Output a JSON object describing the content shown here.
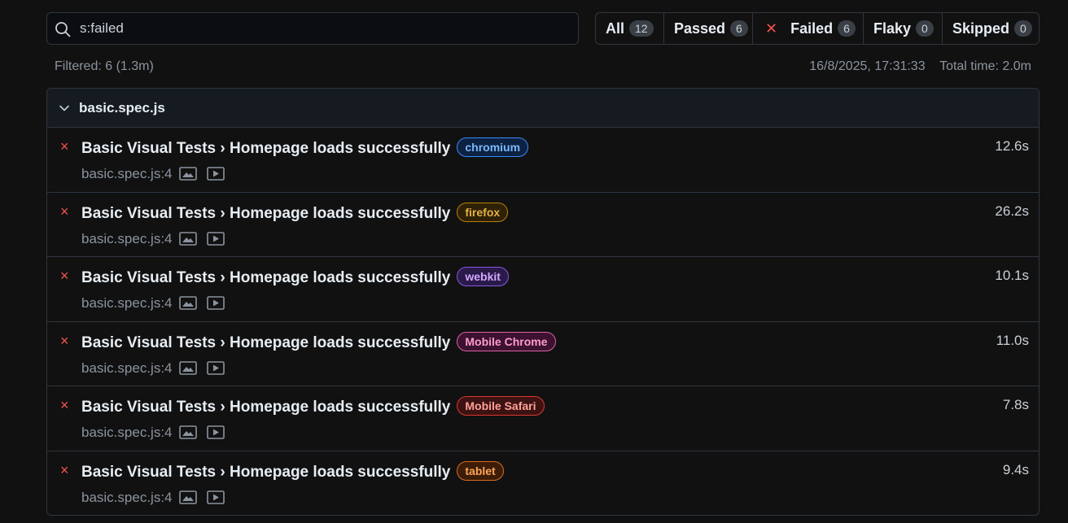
{
  "search": {
    "value": "s:failed",
    "placeholder": ""
  },
  "filters": [
    {
      "label": "All",
      "count": "12",
      "active": false
    },
    {
      "label": "Passed",
      "count": "6",
      "active": false
    },
    {
      "label": "Failed",
      "count": "6",
      "active": true
    },
    {
      "label": "Flaky",
      "count": "0",
      "active": false
    },
    {
      "label": "Skipped",
      "count": "0",
      "active": false
    }
  ],
  "status": {
    "filtered": "Filtered: 6 (1.3m)",
    "timestamp": "16/8/2025, 17:31:33",
    "total_time": "Total time: 2.0m"
  },
  "file": {
    "name": "basic.spec.js"
  },
  "tests": [
    {
      "title": "Basic Visual Tests › Homepage loads successfully",
      "project": "chromium",
      "location": "basic.spec.js:4",
      "duration": "12.6s",
      "badge_color": "#388bfd",
      "badge_bg": "#0d2240",
      "badge_text": "#79b8ff",
      "fail_icon": "×"
    },
    {
      "title": "Basic Visual Tests › Homepage loads successfully",
      "project": "firefox",
      "location": "basic.spec.js:4",
      "duration": "26.2s",
      "badge_color": "#bb8009",
      "badge_bg": "#2e2108",
      "badge_text": "#e3b341",
      "fail_icon": "×"
    },
    {
      "title": "Basic Visual Tests › Homepage loads successfully",
      "project": "webkit",
      "location": "basic.spec.js:4",
      "duration": "10.1s",
      "badge_color": "#8957e5",
      "badge_bg": "#2a1a4a",
      "badge_text": "#d2a8ff",
      "fail_icon": "×"
    },
    {
      "title": "Basic Visual Tests › Homepage loads successfully",
      "project": "Mobile Chrome",
      "location": "basic.spec.js:4",
      "duration": "11.0s",
      "badge_color": "#db61a2",
      "badge_bg": "#3d1230",
      "badge_text": "#ff9bce",
      "fail_icon": "×"
    },
    {
      "title": "Basic Visual Tests › Homepage loads successfully",
      "project": "Mobile Safari",
      "location": "basic.spec.js:4",
      "duration": "7.8s",
      "badge_color": "#da3633",
      "badge_bg": "#3d1212",
      "badge_text": "#ffa198",
      "fail_icon": "×"
    },
    {
      "title": "Basic Visual Tests › Homepage loads successfully",
      "project": "tablet",
      "location": "basic.spec.js:4",
      "duration": "9.4s",
      "badge_color": "#db6d28",
      "badge_bg": "#3d1d08",
      "badge_text": "#ffa657",
      "fail_icon": "×"
    }
  ]
}
